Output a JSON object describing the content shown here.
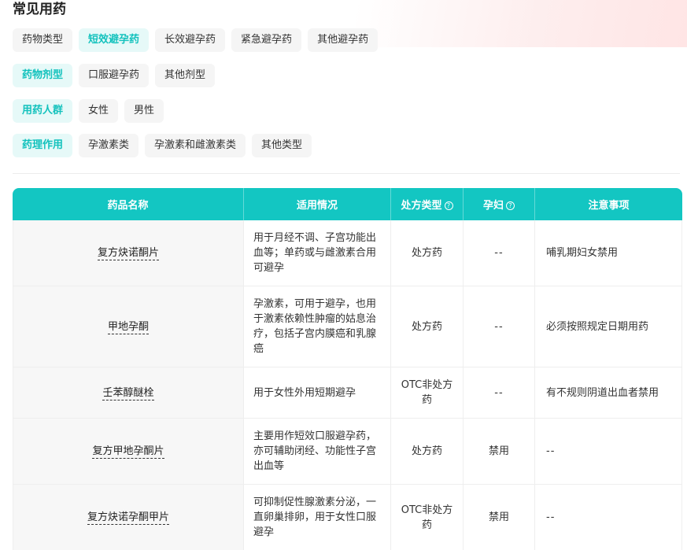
{
  "section_title": "常见用药",
  "filters": {
    "row1": [
      {
        "label": "药物类型",
        "active": false
      },
      {
        "label": "短效避孕药",
        "active": true
      },
      {
        "label": "长效避孕药",
        "active": false
      },
      {
        "label": "紧急避孕药",
        "active": false
      },
      {
        "label": "其他避孕药",
        "active": false
      }
    ],
    "row2": [
      {
        "label": "药物剂型",
        "active": true
      },
      {
        "label": "口服避孕药",
        "active": false
      },
      {
        "label": "其他剂型",
        "active": false
      }
    ],
    "row3": [
      {
        "label": "用药人群",
        "active": true
      },
      {
        "label": "女性",
        "active": false
      },
      {
        "label": "男性",
        "active": false
      }
    ],
    "row4": [
      {
        "label": "药理作用",
        "active": true
      },
      {
        "label": "孕激素类",
        "active": false
      },
      {
        "label": "孕激素和雌激素类",
        "active": false
      },
      {
        "label": "其他类型",
        "active": false
      }
    ]
  },
  "table": {
    "headers": {
      "name": "药品名称",
      "usage": "适用情况",
      "rx_type": "处方类型",
      "pregnancy": "孕妇",
      "notes": "注意事项"
    },
    "rows": [
      {
        "name": "复方炔诺酮片",
        "usage": "用于月经不调、子宫功能出血等；单药或与雌激素合用可避孕",
        "rx_type": "处方药",
        "pregnancy": "--",
        "notes": "哺乳期妇女禁用"
      },
      {
        "name": "甲地孕酮",
        "usage": "孕激素，可用于避孕，也用于激素依赖性肿瘤的姑息治疗，包括子宫内膜癌和乳腺癌",
        "rx_type": "处方药",
        "pregnancy": "--",
        "notes": "必须按照规定日期用药"
      },
      {
        "name": "壬苯醇醚栓",
        "usage": "用于女性外用短期避孕",
        "rx_type": "OTC非处方药",
        "pregnancy": "--",
        "notes": "有不规则阴道出血者禁用"
      },
      {
        "name": "复方甲地孕酮片",
        "usage": "主要用作短效口服避孕药，亦可辅助闭经、功能性子宫出血等",
        "rx_type": "处方药",
        "pregnancy": "禁用",
        "notes": "--"
      },
      {
        "name": "复方炔诺孕酮甲片",
        "usage": "可抑制促性腺激素分泌，一直卵巢排卵，用于女性口服避孕",
        "rx_type": "OTC非处方药",
        "pregnancy": "禁用",
        "notes": "--"
      }
    ]
  },
  "icons": {
    "help": "question-circle-icon"
  },
  "colors": {
    "accent": "#13c6c2",
    "forbidden": "#e4463b"
  }
}
